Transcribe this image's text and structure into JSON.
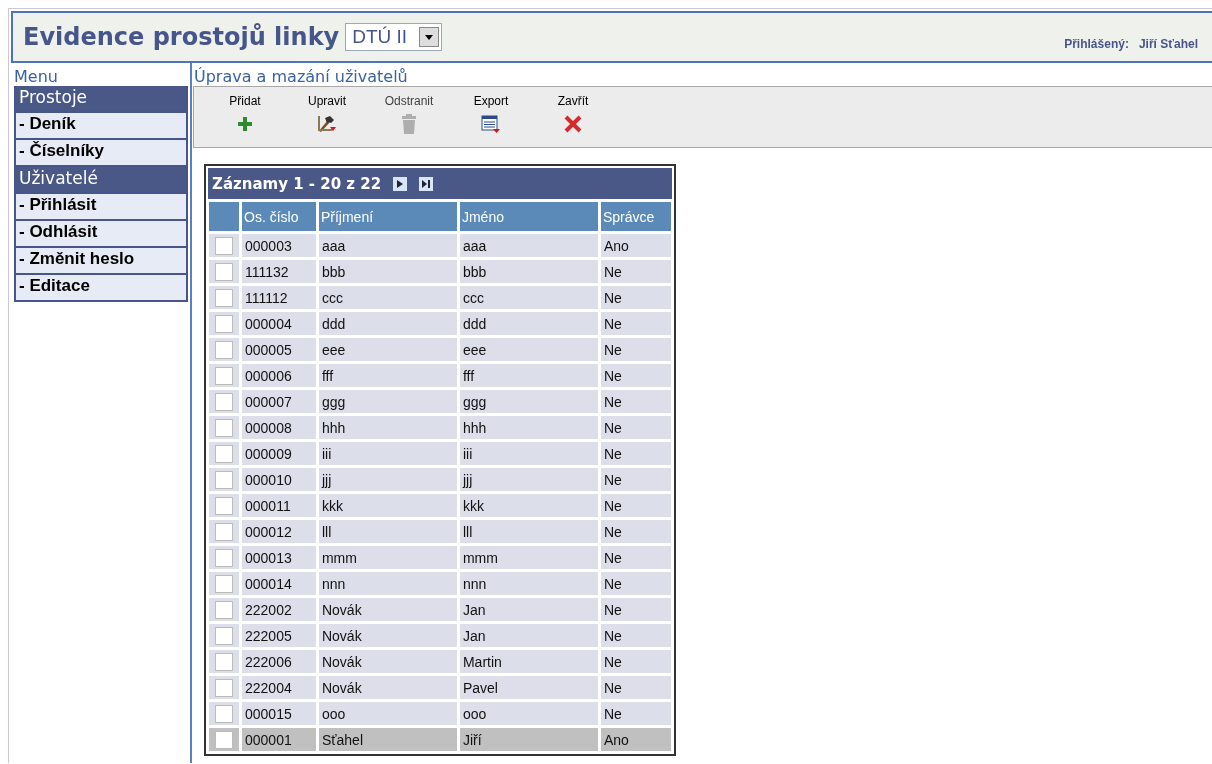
{
  "header": {
    "title": "Evidence prostojů linky",
    "line_select": {
      "value": "DTÚ II"
    },
    "logged_in_label": "Přihlášený:",
    "logged_in_user": "Jiří Sťahel"
  },
  "menu": {
    "title": "Menu",
    "items": [
      {
        "kind": "section",
        "label": "Prostoje"
      },
      {
        "kind": "link",
        "label": "- Deník"
      },
      {
        "kind": "link",
        "label": "- Číselníky"
      },
      {
        "kind": "section",
        "label": "Uživatelé"
      },
      {
        "kind": "link",
        "label": "- Přihlásit"
      },
      {
        "kind": "link",
        "label": "- Odhlásit"
      },
      {
        "kind": "link",
        "label": "- Změnit heslo"
      },
      {
        "kind": "link",
        "label": "- Editace"
      }
    ]
  },
  "content": {
    "title": "Úprava a mazání uživatelů",
    "toolbar": [
      {
        "kind": "add",
        "label": "Přidat",
        "disabled": false
      },
      {
        "kind": "edit",
        "label": "Upravit",
        "disabled": false
      },
      {
        "kind": "delete",
        "label": "Odstranit",
        "disabled": true
      },
      {
        "kind": "export",
        "label": "Export",
        "disabled": false
      },
      {
        "kind": "close",
        "label": "Zavřít",
        "disabled": false
      }
    ],
    "table": {
      "caption": "Záznamy 1 - 20 z 22",
      "columns": [
        "Os. číslo",
        "Příjmení",
        "Jméno",
        "Správce"
      ],
      "rows": [
        {
          "cells": [
            "000003",
            "aaa",
            "aaa",
            "Ano"
          ],
          "checked": false,
          "selected": false
        },
        {
          "cells": [
            "111132",
            "bbb",
            "bbb",
            "Ne"
          ],
          "checked": false,
          "selected": false
        },
        {
          "cells": [
            "111112",
            "ccc",
            "ccc",
            "Ne"
          ],
          "checked": false,
          "selected": false
        },
        {
          "cells": [
            "000004",
            "ddd",
            "ddd",
            "Ne"
          ],
          "checked": false,
          "selected": false
        },
        {
          "cells": [
            "000005",
            "eee",
            "eee",
            "Ne"
          ],
          "checked": false,
          "selected": false
        },
        {
          "cells": [
            "000006",
            "fff",
            "fff",
            "Ne"
          ],
          "checked": false,
          "selected": false
        },
        {
          "cells": [
            "000007",
            "ggg",
            "ggg",
            "Ne"
          ],
          "checked": false,
          "selected": false
        },
        {
          "cells": [
            "000008",
            "hhh",
            "hhh",
            "Ne"
          ],
          "checked": false,
          "selected": false
        },
        {
          "cells": [
            "000009",
            "iii",
            "iii",
            "Ne"
          ],
          "checked": false,
          "selected": false
        },
        {
          "cells": [
            "000010",
            "jjj",
            "jjj",
            "Ne"
          ],
          "checked": false,
          "selected": false
        },
        {
          "cells": [
            "000011",
            "kkk",
            "kkk",
            "Ne"
          ],
          "checked": false,
          "selected": false
        },
        {
          "cells": [
            "000012",
            "lll",
            "lll",
            "Ne"
          ],
          "checked": false,
          "selected": false
        },
        {
          "cells": [
            "000013",
            "mmm",
            "mmm",
            "Ne"
          ],
          "checked": false,
          "selected": false
        },
        {
          "cells": [
            "000014",
            "nnn",
            "nnn",
            "Ne"
          ],
          "checked": false,
          "selected": false
        },
        {
          "cells": [
            "222002",
            "Novák",
            "Jan",
            "Ne"
          ],
          "checked": false,
          "selected": false
        },
        {
          "cells": [
            "222005",
            "Novák",
            "Jan",
            "Ne"
          ],
          "checked": false,
          "selected": false
        },
        {
          "cells": [
            "222006",
            "Novák",
            "Martin",
            "Ne"
          ],
          "checked": false,
          "selected": false
        },
        {
          "cells": [
            "222004",
            "Novák",
            "Pavel",
            "Ne"
          ],
          "checked": false,
          "selected": false
        },
        {
          "cells": [
            "000015",
            "ooo",
            "ooo",
            "Ne"
          ],
          "checked": false,
          "selected": false
        },
        {
          "cells": [
            "000001",
            "Sťahel",
            "Jiří",
            "Ano"
          ],
          "checked": false,
          "selected": true
        }
      ]
    }
  }
}
